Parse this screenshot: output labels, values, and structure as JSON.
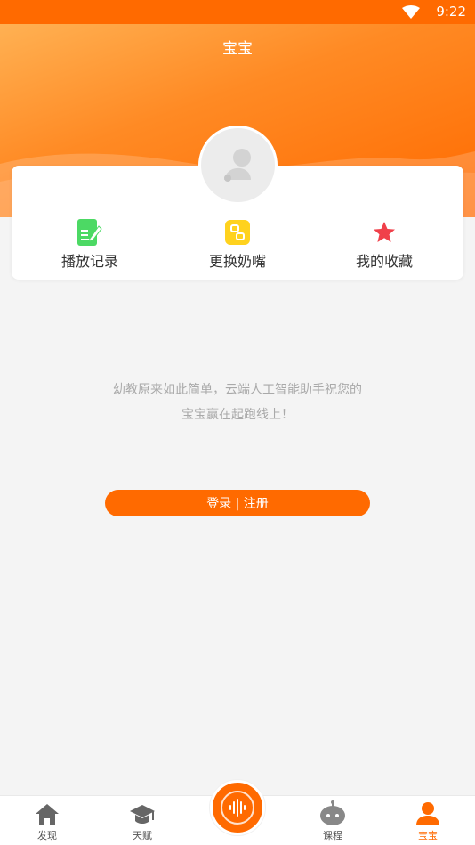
{
  "status_bar": {
    "time": "9:22"
  },
  "header": {
    "title": "宝宝"
  },
  "actions": [
    {
      "label": "播放记录",
      "icon": "document-edit-icon",
      "color": "#4cd964"
    },
    {
      "label": "更换奶嘴",
      "icon": "pacifier-icon",
      "color": "#ffd21e"
    },
    {
      "label": "我的收藏",
      "icon": "star-icon",
      "color": "#f0404a"
    }
  ],
  "main": {
    "tagline_line1": "幼教原来如此简单，云端人工智能助手祝您的",
    "tagline_line2": "宝宝赢在起跑线上！",
    "login_label": "登录 | 注册"
  },
  "tabbar": {
    "tabs": [
      {
        "label": "发现",
        "icon": "home-icon"
      },
      {
        "label": "天赋",
        "icon": "graduation-cap-icon"
      },
      {
        "label": "",
        "icon": "voice-wave-icon"
      },
      {
        "label": "课程",
        "icon": "robot-icon"
      },
      {
        "label": "宝宝",
        "icon": "person-icon",
        "active": true
      }
    ]
  },
  "colors": {
    "accent": "#ff6a00",
    "background": "#f4f4f4"
  }
}
